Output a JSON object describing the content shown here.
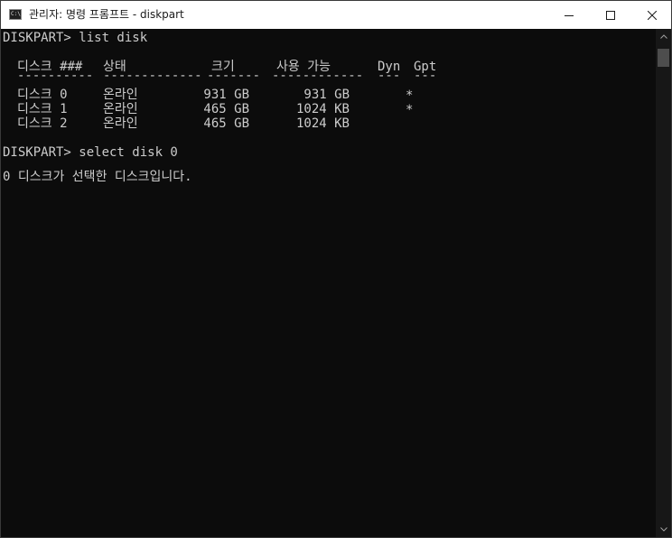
{
  "window": {
    "title": "관리자: 명령 프롬프트 - diskpart",
    "icon_text": "C:\\",
    "controls": {
      "minimize": "minimize-icon",
      "maximize": "maximize-icon",
      "close": "close-icon"
    }
  },
  "console": {
    "prompt1": "DISKPART> list disk",
    "headers": {
      "disk": "디스크 ###",
      "status": "상태",
      "size": "크기",
      "free": "사용 가능",
      "dyn": "Dyn",
      "gpt": "Gpt"
    },
    "dividers": {
      "disk": "----------",
      "status": "-------------",
      "size": "-------",
      "free": "------------",
      "dyn": "---",
      "gpt": "---"
    },
    "rows": [
      {
        "disk": "디스크 0",
        "status": "온라인",
        "size": "931 GB",
        "free": "931 GB",
        "dyn": "",
        "gpt": "*"
      },
      {
        "disk": "디스크 1",
        "status": "온라인",
        "size": "465 GB",
        "free": "1024 KB",
        "dyn": "",
        "gpt": "*"
      },
      {
        "disk": "디스크 2",
        "status": "온라인",
        "size": "465 GB",
        "free": "1024 KB",
        "dyn": "",
        "gpt": ""
      }
    ],
    "prompt2": "DISKPART> select disk 0",
    "result": "0 디스크가 선택한 디스크입니다."
  },
  "colors": {
    "console_bg": "#0c0c0c",
    "console_text": "#cccccc",
    "titlebar_bg": "#ffffff",
    "scrollbar_bg": "#171717",
    "scrollbar_thumb": "#4d4d4d"
  }
}
